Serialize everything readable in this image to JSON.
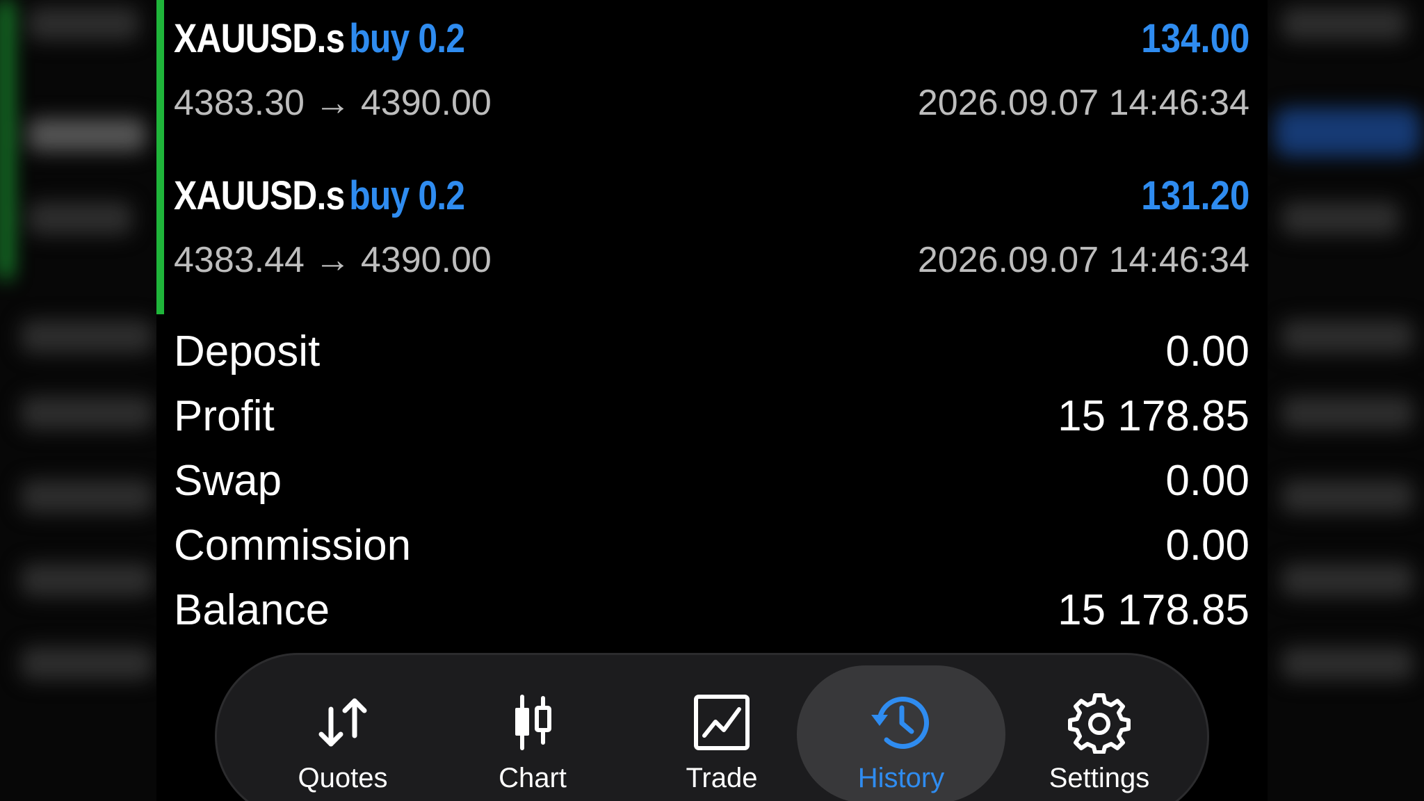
{
  "deals": [
    {
      "symbol": "XAUUSD.s",
      "direction": "buy 0.2",
      "profit": "134.00",
      "open_price": "4383.30",
      "close_price": "4390.00",
      "arrow": "→",
      "time": "2026.09.07 14:46:34"
    },
    {
      "symbol": "XAUUSD.s",
      "direction": "buy 0.2",
      "profit": "131.20",
      "open_price": "4383.44",
      "close_price": "4390.00",
      "arrow": "→",
      "time": "2026.09.07 14:46:34"
    }
  ],
  "summary": [
    {
      "label": "Deposit",
      "value": "0.00"
    },
    {
      "label": "Profit",
      "value": "15 178.85"
    },
    {
      "label": "Swap",
      "value": "0.00"
    },
    {
      "label": "Commission",
      "value": "0.00"
    },
    {
      "label": "Balance",
      "value": "15 178.85"
    }
  ],
  "tabs": [
    {
      "label": "Quotes",
      "icon": "quotes-arrows-icon",
      "active": false
    },
    {
      "label": "Chart",
      "icon": "candlestick-icon",
      "active": false
    },
    {
      "label": "Trade",
      "icon": "trade-chart-icon",
      "active": false
    },
    {
      "label": "History",
      "icon": "history-clock-icon",
      "active": true
    },
    {
      "label": "Settings",
      "icon": "gear-icon",
      "active": false
    }
  ],
  "colors": {
    "accent_blue": "#2f8cf0",
    "profit_bar_green": "#1fb53a",
    "muted_text": "#bdbdbd",
    "tabbar_bg": "#1c1c1e"
  }
}
